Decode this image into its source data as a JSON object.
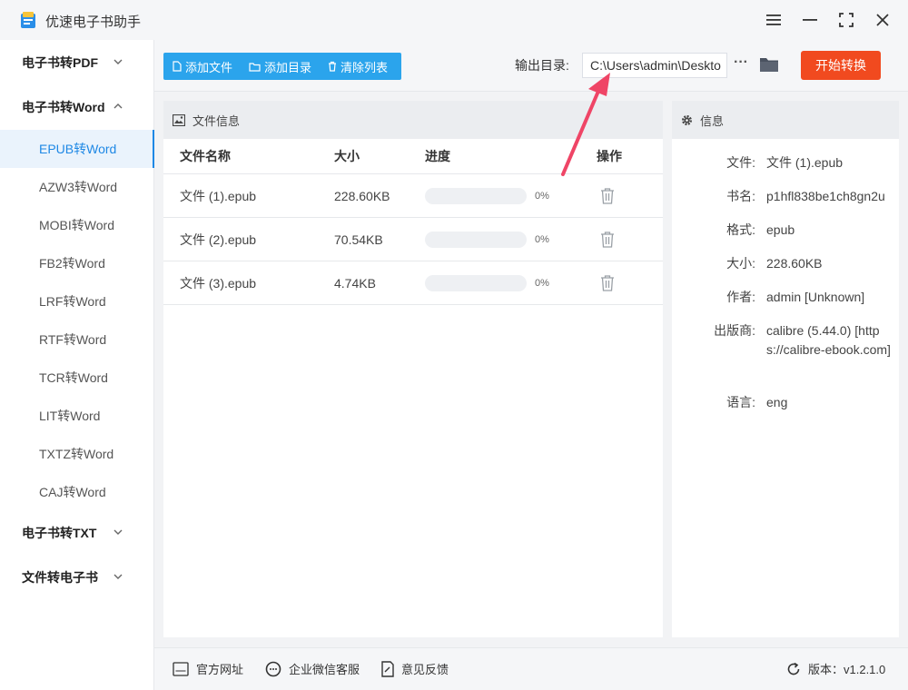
{
  "app": {
    "title": "优速电子书助手",
    "accent": "#2ba4ec",
    "primary_action_color": "#f14a1f"
  },
  "window_controls": [
    "menu-icon",
    "minimize-icon",
    "maximize-icon",
    "close-icon"
  ],
  "sidebar": {
    "groups": [
      {
        "label": "电子书转PDF",
        "expanded": false
      },
      {
        "label": "电子书转Word",
        "expanded": true
      },
      {
        "label": "电子书转TXT",
        "expanded": false
      },
      {
        "label": "文件转电子书",
        "expanded": false
      }
    ],
    "word_items": [
      {
        "label": "EPUB转Word",
        "active": true
      },
      {
        "label": "AZW3转Word"
      },
      {
        "label": "MOBI转Word"
      },
      {
        "label": "FB2转Word"
      },
      {
        "label": "LRF转Word"
      },
      {
        "label": "RTF转Word"
      },
      {
        "label": "TCR转Word"
      },
      {
        "label": "LIT转Word"
      },
      {
        "label": "TXTZ转Word"
      },
      {
        "label": "CAJ转Word"
      }
    ]
  },
  "toolbar": {
    "add_file": "添加文件",
    "add_dir": "添加目录",
    "clear_list": "清除列表",
    "output_label": "输出目录:",
    "output_value": "C:\\Users\\admin\\Deskto",
    "more": "···",
    "start": "开始转换"
  },
  "file_panel": {
    "title": "文件信息",
    "columns": {
      "name": "文件名称",
      "size": "大小",
      "progress": "进度",
      "action": "操作"
    },
    "rows": [
      {
        "name": "文件 (1).epub",
        "size": "228.60KB",
        "progress": 0,
        "progress_text": "0%"
      },
      {
        "name": "文件 (2).epub",
        "size": "70.54KB",
        "progress": 0,
        "progress_text": "0%"
      },
      {
        "name": "文件 (3).epub",
        "size": "4.74KB",
        "progress": 0,
        "progress_text": "0%"
      }
    ]
  },
  "info_panel": {
    "title": "信息",
    "fields": [
      {
        "key": "文件:",
        "value": "文件 (1).epub"
      },
      {
        "key": "书名:",
        "value": "p1hfl838be1ch8gn2u"
      },
      {
        "key": "格式:",
        "value": "epub"
      },
      {
        "key": "大小:",
        "value": "228.60KB"
      },
      {
        "key": "作者:",
        "value": "admin [Unknown]"
      },
      {
        "key": "出版商:",
        "value": "calibre (5.44.0) [https://calibre-ebook.com]"
      },
      {
        "key": "语言:",
        "value": "eng"
      }
    ]
  },
  "footer": {
    "website": "官方网址",
    "wechat": "企业微信客服",
    "feedback": "意见反馈",
    "version": "版本：v1.2.1.0"
  }
}
